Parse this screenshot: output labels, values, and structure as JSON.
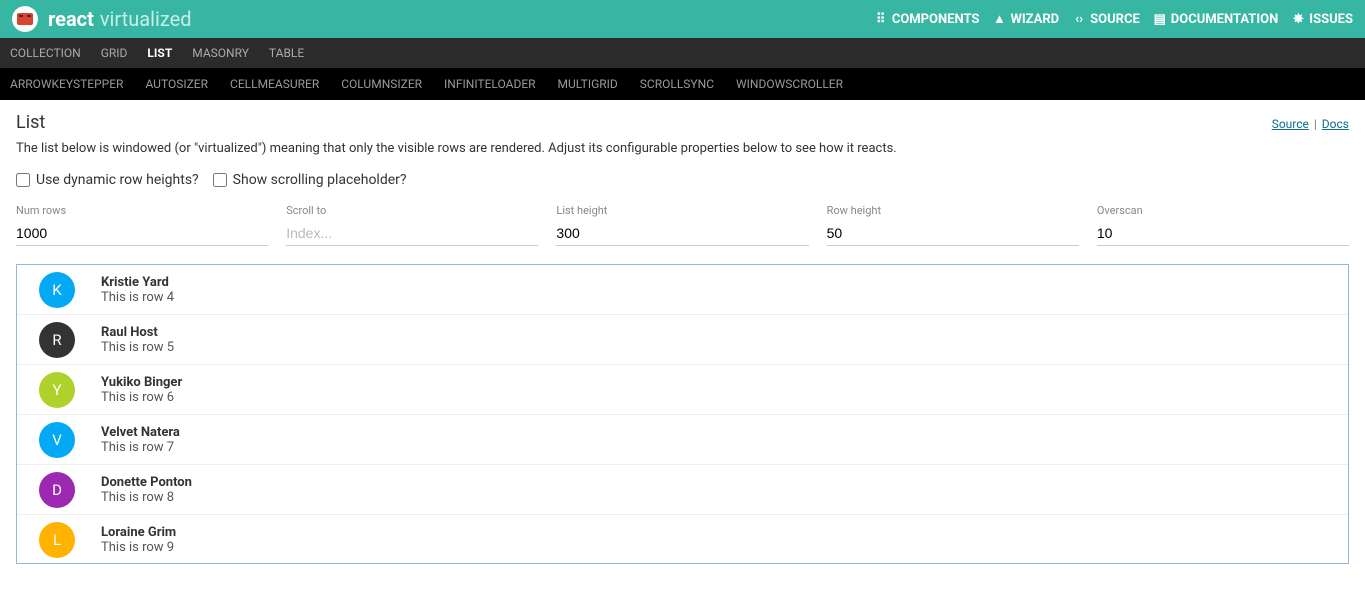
{
  "header": {
    "brand1": "react",
    "brand2": "virtualized",
    "nav": [
      {
        "icon": "grid-icon",
        "label": "COMPONENTS"
      },
      {
        "icon": "wizard-icon",
        "label": "WIZARD"
      },
      {
        "icon": "source-icon",
        "label": "SOURCE"
      },
      {
        "icon": "docs-icon",
        "label": "DOCUMENTATION"
      },
      {
        "icon": "issues-icon",
        "label": "ISSUES"
      }
    ]
  },
  "subnav": [
    {
      "label": "COLLECTION",
      "active": false
    },
    {
      "label": "GRID",
      "active": false
    },
    {
      "label": "LIST",
      "active": true
    },
    {
      "label": "MASONRY",
      "active": false
    },
    {
      "label": "TABLE",
      "active": false
    }
  ],
  "subsubnav": [
    "ARROWKEYSTEPPER",
    "AUTOSIZER",
    "CELLMEASURER",
    "COLUMNSIZER",
    "INFINITELOADER",
    "MULTIGRID",
    "SCROLLSYNC",
    "WINDOWSCROLLER"
  ],
  "page": {
    "title": "List",
    "source_link": "Source",
    "docs_link": "Docs",
    "sep": "|",
    "description": "The list below is windowed (or \"virtualized\") meaning that only the visible rows are rendered. Adjust its configurable properties below to see how it reacts."
  },
  "checks": {
    "dynamic": "Use dynamic row heights?",
    "placeholder": "Show scrolling placeholder?"
  },
  "fields": {
    "numrows": {
      "label": "Num rows",
      "value": "1000"
    },
    "scrollto": {
      "label": "Scroll to",
      "placeholder": "Index..."
    },
    "listheight": {
      "label": "List height",
      "value": "300"
    },
    "rowheight": {
      "label": "Row height",
      "value": "50"
    },
    "overscan": {
      "label": "Overscan",
      "value": "10"
    }
  },
  "rows": [
    {
      "initial": "K",
      "name": "Kristie Yard",
      "sub": "This is row 4",
      "color": "#03a9f4"
    },
    {
      "initial": "R",
      "name": "Raul Host",
      "sub": "This is row 5",
      "color": "#333333"
    },
    {
      "initial": "Y",
      "name": "Yukiko Binger",
      "sub": "This is row 6",
      "color": "#aed22b"
    },
    {
      "initial": "V",
      "name": "Velvet Natera",
      "sub": "This is row 7",
      "color": "#03a9f4"
    },
    {
      "initial": "D",
      "name": "Donette Ponton",
      "sub": "This is row 8",
      "color": "#9c27b0"
    },
    {
      "initial": "L",
      "name": "Loraine Grim",
      "sub": "This is row 9",
      "color": "#ffb300"
    }
  ],
  "nav_icons": {
    "grid-icon": "⠿",
    "wizard-icon": "▲",
    "source-icon": "‹›",
    "docs-icon": "▤",
    "issues-icon": "✸"
  }
}
